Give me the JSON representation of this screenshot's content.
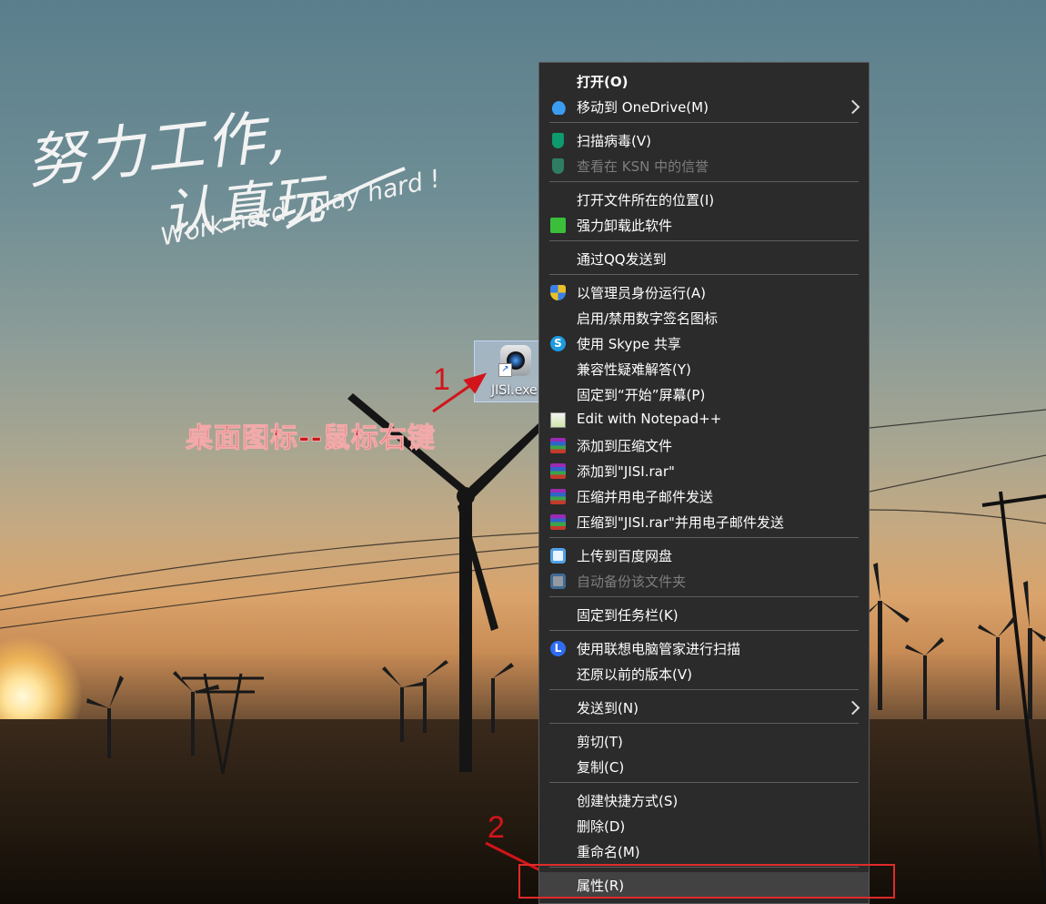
{
  "wallpaper": {
    "calligraphy_line1": "努力工作,",
    "calligraphy_line2": "认真玩",
    "calligraphy_en": "Work hard , play hard !"
  },
  "desktop_icon": {
    "label": "JISI.exe"
  },
  "annotations": {
    "step1_number": "1",
    "step1_text": "桌面图标--鼠标右键",
    "step2_number": "2",
    "accent_color": "#e12a2a"
  },
  "context_menu": {
    "items": [
      {
        "label": "打开(O)",
        "icon": null
      },
      {
        "label": "移动到 OneDrive(M)",
        "icon": "onedrive-icon",
        "submenu": true
      },
      {
        "label": "扫描病毒(V)",
        "icon": "kaspersky-shield-icon"
      },
      {
        "label": "查看在 KSN 中的信誉",
        "icon": "kaspersky-shield-icon",
        "disabled": true
      },
      {
        "label": "打开文件所在的位置(I)",
        "icon": null
      },
      {
        "label": "强力卸载此软件",
        "icon": "uninstall-bin-icon"
      },
      {
        "label": "通过QQ发送到",
        "icon": null
      },
      {
        "label": "以管理员身份运行(A)",
        "icon": "uac-shield-icon"
      },
      {
        "label": "启用/禁用数字签名图标",
        "icon": null
      },
      {
        "label": "使用 Skype 共享",
        "icon": "skype-icon"
      },
      {
        "label": "兼容性疑难解答(Y)",
        "icon": null
      },
      {
        "label": "固定到“开始”屏幕(P)",
        "icon": null
      },
      {
        "label": "Edit with Notepad++",
        "icon": "notepad-plus-plus-icon"
      },
      {
        "label": "添加到压缩文件",
        "icon": "winrar-icon"
      },
      {
        "label": "添加到\"JISI.rar\"",
        "icon": "winrar-icon"
      },
      {
        "label": "压缩并用电子邮件发送",
        "icon": "winrar-icon"
      },
      {
        "label": "压缩到\"JISI.rar\"并用电子邮件发送",
        "icon": "winrar-icon"
      },
      {
        "label": "上传到百度网盘",
        "icon": "baidu-netdisk-icon"
      },
      {
        "label": "自动备份该文件夹",
        "icon": "baidu-netdisk-icon",
        "disabled": true
      },
      {
        "label": "固定到任务栏(K)",
        "icon": null
      },
      {
        "label": "使用联想电脑管家进行扫描",
        "icon": "lenovo-icon"
      },
      {
        "label": "还原以前的版本(V)",
        "icon": null
      },
      {
        "label": "发送到(N)",
        "icon": null,
        "submenu": true
      },
      {
        "label": "剪切(T)",
        "icon": null
      },
      {
        "label": "复制(C)",
        "icon": null
      },
      {
        "label": "创建快捷方式(S)",
        "icon": null
      },
      {
        "label": "删除(D)",
        "icon": null
      },
      {
        "label": "重命名(M)",
        "icon": null
      },
      {
        "label": "属性(R)",
        "icon": null,
        "highlighted": true
      }
    ],
    "skype_glyph": "S",
    "lenovo_glyph": "L"
  }
}
